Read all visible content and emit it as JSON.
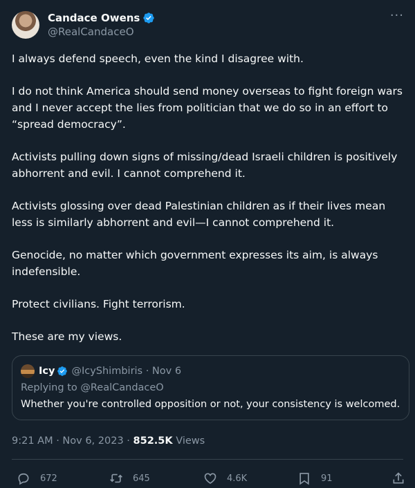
{
  "author": {
    "name": "Candace Owens",
    "handle": "@RealCandaceO"
  },
  "more_menu": "···",
  "tweet": {
    "paragraphs": [
      "I always defend speech, even the kind I disagree with.",
      "I do not think America should send money overseas to fight foreign wars and I never accept the lies from politician that we do so in an effort to “spread democracy”.",
      "Activists pulling down signs of missing/dead Israeli children is positively abhorrent and evil. I cannot comprehend it.",
      "Activists glossing over dead Palestinian children as if their lives mean less is similarly abhorrent and evil—I cannot comprehend it.",
      "Genocide, no matter which government expresses its aim, is always indefensible.",
      "Protect civilians. Fight terrorism.",
      "These are my views."
    ]
  },
  "quote": {
    "name": "Icy",
    "handle_date": "@IcyShimbiris · Nov 6",
    "replying_to": "Replying to @RealCandaceO",
    "text": "Whether you're controlled opposition or not, your consistency is welcomed."
  },
  "meta": {
    "time_date": "9:21 AM · Nov 6, 2023 · ",
    "views_count": "852.5K",
    "views_label": " Views"
  },
  "actions": {
    "replies": "672",
    "retweets": "645",
    "likes": "4.6K",
    "bookmarks": "91"
  },
  "colors": {
    "background": "#15202b",
    "text": "#f7f9f9",
    "secondary": "#8b98a5",
    "verified": "#1d9bf0",
    "border": "#38444d"
  }
}
